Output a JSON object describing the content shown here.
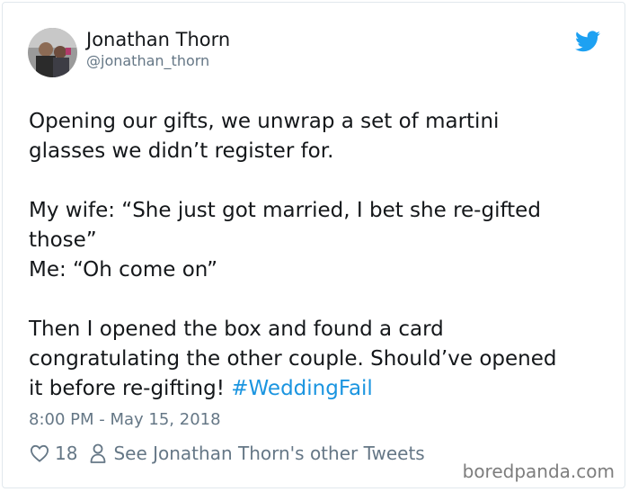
{
  "tweet": {
    "author_name": "Jonathan Thorn",
    "handle": "@jonathan_thorn",
    "text": "Opening our gifts, we unwrap a set of martini\nglasses  we didn’t register for.\n\nMy wife: “She just got married, I bet she re-gifted\nthose”\nMe: “Oh come on”\n\nThen I opened the box and found a card\ncongratulating the other couple. Should’ve opened\nit before re-gifting! ",
    "hashtag": "#WeddingFail",
    "timestamp": "8:00 PM - May 15, 2018",
    "likes": "18",
    "see_more": "See Jonathan Thorn's other Tweets"
  },
  "watermark": "boredpanda.com",
  "icons": {
    "brand": "twitter-bird-icon",
    "like": "heart-icon",
    "profile": "person-icon"
  },
  "colors": {
    "twitter_blue": "#1da1f2",
    "hashtag": "#1b95e0",
    "secondary_text": "#657786"
  }
}
